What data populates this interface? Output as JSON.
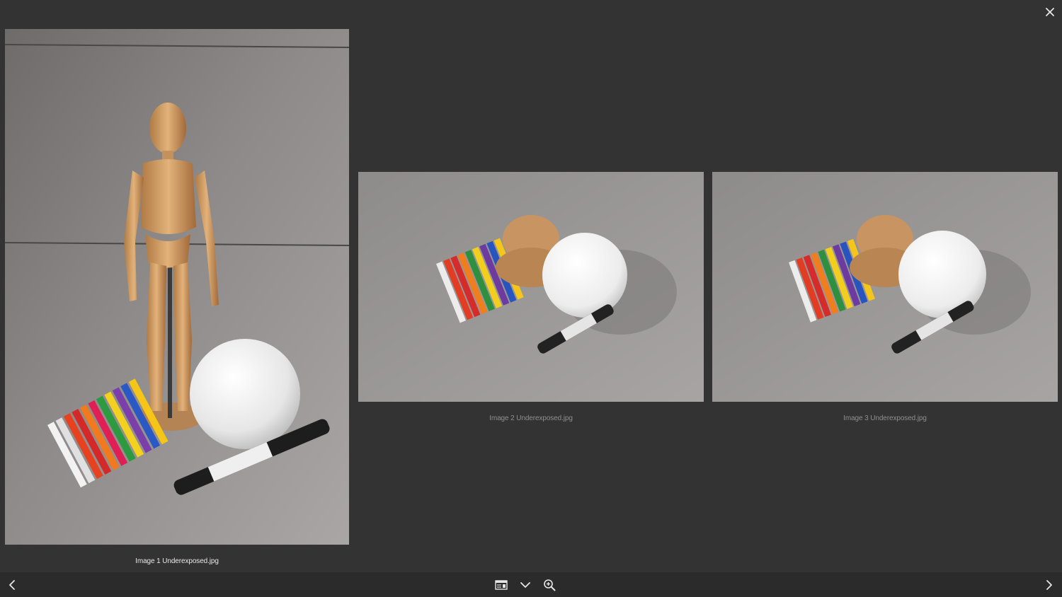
{
  "viewer": {
    "photos": [
      {
        "filename": "Image 1 Underexposed.jpg",
        "selected": true
      },
      {
        "filename": "Image 2 Underexposed.jpg",
        "selected": false
      },
      {
        "filename": "Image 3 Underexposed.jpg",
        "selected": false
      }
    ]
  },
  "icons": {
    "close": "close-icon",
    "previous": "chevron-left-icon",
    "next": "chevron-right-icon",
    "info": "info-panel-icon",
    "expand": "chevron-down-icon",
    "zoom": "zoom-in-icon"
  },
  "colors": {
    "background": "#333333",
    "toolbar": "#2b2b2b",
    "caption_active": "#e8e8e8",
    "caption_inactive": "#8f8f8f"
  }
}
